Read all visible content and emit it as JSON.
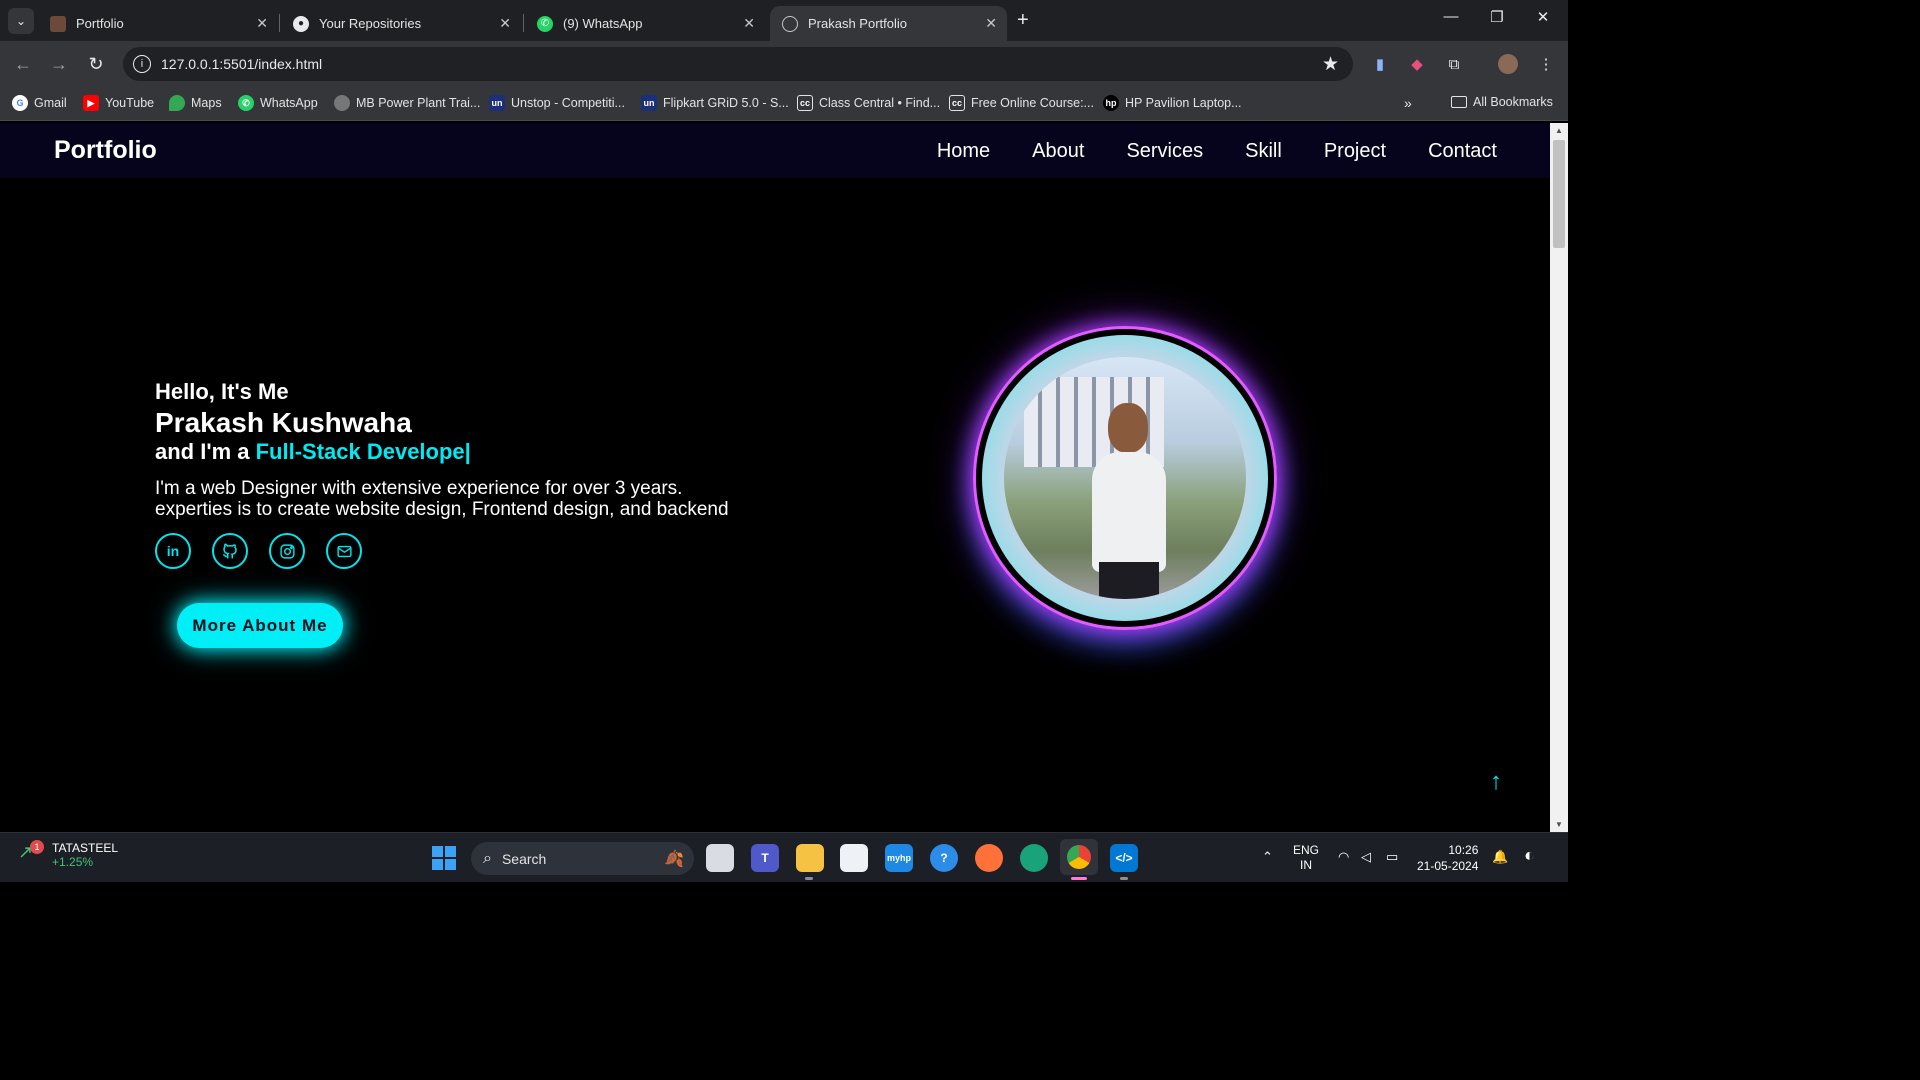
{
  "browser": {
    "tabs": [
      {
        "title": "Portfolio",
        "icon": "portfolio-favicon"
      },
      {
        "title": "Your Repositories",
        "icon": "github-icon"
      },
      {
        "title": "(9) WhatsApp",
        "icon": "whatsapp-icon"
      },
      {
        "title": "Prakash Portfolio",
        "icon": "globe-icon",
        "active": true
      }
    ],
    "url": "127.0.0.1:5501/index.html",
    "bookmarks": [
      "Gmail",
      "YouTube",
      "Maps",
      "WhatsApp",
      "MB Power Plant Trai...",
      "Unstop - Competiti...",
      "Flipkart GRiD 5.0 - S...",
      "Class Central • Find...",
      "Free Online Course:...",
      "HP Pavilion Laptop..."
    ],
    "all_bookmarks": "All Bookmarks"
  },
  "site": {
    "logo": "Portfolio",
    "nav": [
      "Home",
      "About",
      "Services",
      "Skill",
      "Project",
      "Contact"
    ],
    "hero": {
      "greeting": "Hello, It's Me",
      "name": "Prakash Kushwaha",
      "role_prefix": "and I'm a ",
      "role_highlight": "Full-Stack Develope|",
      "bio_line1": "I'm a web Designer with extensive experience for over 3 years.",
      "bio_line2": "experties is to create website design, Frontend design, and backend",
      "socials": [
        "linkedin-icon",
        "github-icon",
        "instagram-icon",
        "mail-icon"
      ],
      "cta": "More About Me"
    },
    "accent": "#00eaf2",
    "header_bg": "#05041c"
  },
  "taskbar": {
    "stock_name": "TATASTEEL",
    "stock_change": "+1.25%",
    "stock_badge": "1",
    "search": "Search",
    "lang_line1": "ENG",
    "lang_line2": "IN",
    "time": "10:26",
    "date": "21-05-2024"
  }
}
